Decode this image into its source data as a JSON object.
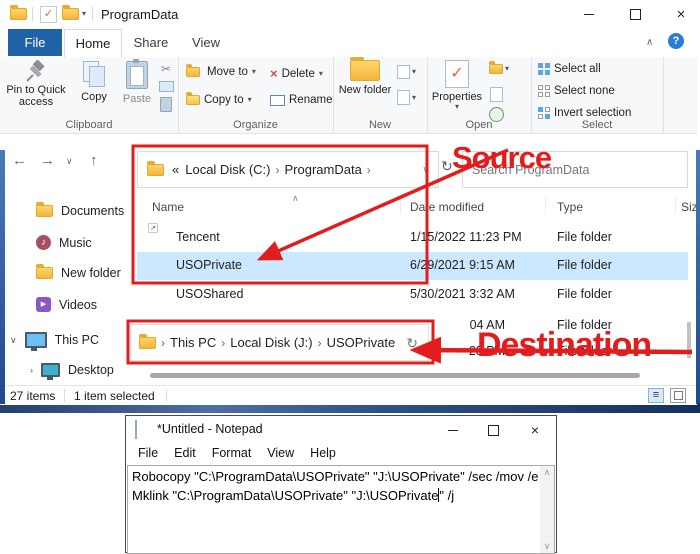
{
  "ui": {
    "sep": "›",
    "laquo": "«",
    "icons": {
      "back": "←",
      "forward": "→",
      "up": "↑",
      "chev_down": "∨",
      "chev_up": "∧",
      "refresh": "↻",
      "close": "×",
      "help": "?",
      "details": "≡",
      "play": "▶",
      "note": "♪",
      "check": "✓",
      "shortcut_arrow": "↗",
      "caret_down": "▾",
      "delete_x": "×",
      "scissors": "✂",
      "sort": "∧"
    }
  },
  "annotations": {
    "source_label": "Source",
    "destination_label": "Destination",
    "color": "#e21d1d"
  },
  "explorer": {
    "window_title": "ProgramData",
    "tabs": [
      {
        "label": "File"
      },
      {
        "label": "Home"
      },
      {
        "label": "Share"
      },
      {
        "label": "View"
      }
    ],
    "ribbon": {
      "clipboard": {
        "label": "Clipboard",
        "pin": "Pin to Quick access",
        "copy": "Copy",
        "paste": "Paste"
      },
      "organize": {
        "label": "Organize",
        "move_to": "Move to",
        "copy_to": "Copy to",
        "del": "Delete",
        "rename": "Rename"
      },
      "new_group": {
        "label": "New",
        "new_folder": "New folder"
      },
      "open_group": {
        "label": "Open",
        "properties": "Properties"
      },
      "select_group": {
        "label": "Select",
        "select_all": "Select all",
        "select_none": "Select none",
        "invert": "Invert selection"
      }
    },
    "address": {
      "crumb1": "Local Disk (C:)",
      "crumb2": "ProgramData"
    },
    "search": {
      "placeholder": "Search ProgramData"
    },
    "sidebar": {
      "items": [
        {
          "label": "Documents"
        },
        {
          "label": "Music"
        },
        {
          "label": "New folder"
        },
        {
          "label": "Videos"
        },
        {
          "label": "This PC"
        },
        {
          "label": "Desktop"
        }
      ]
    },
    "list": {
      "columns": {
        "name": "Name",
        "date": "Date modified",
        "type": "Type",
        "size": "Size"
      },
      "rows": [
        {
          "name": "Tencent",
          "date": "1/15/2022 11:23 PM",
          "type": "File folder"
        },
        {
          "name": "USOPrivate",
          "date": "6/29/2021 9:15 AM",
          "type": "File folder"
        },
        {
          "name": "USOShared",
          "date": "5/30/2021 3:32 AM",
          "type": "File folder"
        }
      ],
      "partial_rows": [
        {
          "date": "04 AM",
          "type": "File folder"
        },
        {
          "date": "23 PM",
          "type": "File folder"
        }
      ]
    },
    "status": {
      "items": "27 items",
      "selected": "1 item selected"
    }
  },
  "destination_bar": {
    "crumbs": {
      "c1": "This PC",
      "c2": "Local Disk (J:)",
      "c3": "USOPrivate"
    }
  },
  "notepad": {
    "title": "*Untitled - Notepad",
    "menu": [
      {
        "label": "File"
      },
      {
        "label": "Edit"
      },
      {
        "label": "Format"
      },
      {
        "label": "View"
      },
      {
        "label": "Help"
      }
    ],
    "line1": "Robocopy \"C:\\ProgramData\\USOPrivate\" \"J:\\USOPrivate\" /sec /mov /e",
    "line2_before_caret": "Mklink \"C:\\ProgramData\\USOPrivate\" \"J:\\USOPrivate",
    "line2_after_caret": "\" /j"
  }
}
